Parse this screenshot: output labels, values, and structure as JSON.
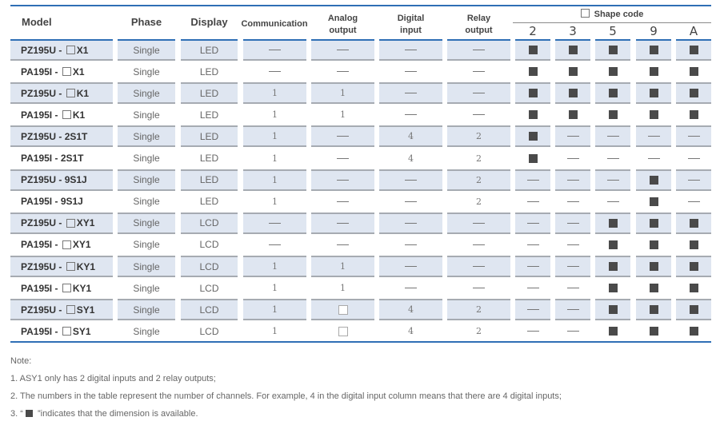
{
  "headers": {
    "model": "Model",
    "phase": "Phase",
    "display": "Display",
    "communication": "Communication",
    "analog_output": [
      "Analog",
      "output"
    ],
    "digital_input": [
      "Digital",
      "input"
    ],
    "relay_output": [
      "Relay",
      "output"
    ],
    "shape_code": "Shape code",
    "shape_codes": [
      "2",
      "3",
      "5",
      "9",
      "A"
    ]
  },
  "symbols": {
    "dash": "—",
    "filled": "filled-square",
    "empty": "empty-square"
  },
  "rows": [
    {
      "model_prefix": "PZ195U - ",
      "model_box": true,
      "model_suffix": "X1",
      "phase": "Single",
      "display": "LED",
      "communication": "—",
      "analog_output": "—",
      "digital_input": "—",
      "relay_output": "—",
      "shape": [
        "filled",
        "filled",
        "filled",
        "filled",
        "filled"
      ]
    },
    {
      "model_prefix": "PA195I - ",
      "model_box": true,
      "model_suffix": "X1",
      "phase": "Single",
      "display": "LED",
      "communication": "—",
      "analog_output": "—",
      "digital_input": "—",
      "relay_output": "—",
      "shape": [
        "filled",
        "filled",
        "filled",
        "filled",
        "filled"
      ]
    },
    {
      "model_prefix": "PZ195U - ",
      "model_box": true,
      "model_suffix": "K1",
      "phase": "Single",
      "display": "LED",
      "communication": "1",
      "analog_output": "1",
      "digital_input": "—",
      "relay_output": "—",
      "shape": [
        "filled",
        "filled",
        "filled",
        "filled",
        "filled"
      ]
    },
    {
      "model_prefix": "PA195I - ",
      "model_box": true,
      "model_suffix": "K1",
      "phase": "Single",
      "display": "LED",
      "communication": "1",
      "analog_output": "1",
      "digital_input": "—",
      "relay_output": "—",
      "shape": [
        "filled",
        "filled",
        "filled",
        "filled",
        "filled"
      ]
    },
    {
      "model_prefix": "PZ195U - ",
      "model_box": false,
      "model_suffix": "2S1T",
      "phase": "Single",
      "display": "LED",
      "communication": "1",
      "analog_output": "—",
      "digital_input": "4",
      "relay_output": "2",
      "shape": [
        "filled",
        "dash",
        "dash",
        "dash",
        "dash"
      ]
    },
    {
      "model_prefix": "PA195I - ",
      "model_box": false,
      "model_suffix": "2S1T",
      "phase": "Single",
      "display": "LED",
      "communication": "1",
      "analog_output": "—",
      "digital_input": "4",
      "relay_output": "2",
      "shape": [
        "filled",
        "dash",
        "dash",
        "dash",
        "dash"
      ]
    },
    {
      "model_prefix": "PZ195U - ",
      "model_box": false,
      "model_suffix": "9S1J",
      "phase": "Single",
      "display": "LED",
      "communication": "1",
      "analog_output": "—",
      "digital_input": "—",
      "relay_output": "2",
      "shape": [
        "dash",
        "dash",
        "dash",
        "filled",
        "dash"
      ]
    },
    {
      "model_prefix": "PA195I - ",
      "model_box": false,
      "model_suffix": "9S1J",
      "phase": "Single",
      "display": "LED",
      "communication": "1",
      "analog_output": "—",
      "digital_input": "—",
      "relay_output": "2",
      "shape": [
        "dash",
        "dash",
        "dash",
        "filled",
        "dash"
      ]
    },
    {
      "model_prefix": "PZ195U - ",
      "model_box": true,
      "model_suffix": "XY1",
      "phase": "Single",
      "display": "LCD",
      "communication": "—",
      "analog_output": "—",
      "digital_input": "—",
      "relay_output": "—",
      "shape": [
        "dash",
        "dash",
        "filled",
        "filled",
        "filled"
      ]
    },
    {
      "model_prefix": "PA195I - ",
      "model_box": true,
      "model_suffix": "XY1",
      "phase": "Single",
      "display": "LCD",
      "communication": "—",
      "analog_output": "—",
      "digital_input": "—",
      "relay_output": "—",
      "shape": [
        "dash",
        "dash",
        "filled",
        "filled",
        "filled"
      ]
    },
    {
      "model_prefix": "PZ195U - ",
      "model_box": true,
      "model_suffix": "KY1",
      "phase": "Single",
      "display": "LCD",
      "communication": "1",
      "analog_output": "1",
      "digital_input": "—",
      "relay_output": "—",
      "shape": [
        "dash",
        "dash",
        "filled",
        "filled",
        "filled"
      ]
    },
    {
      "model_prefix": "PA195I - ",
      "model_box": true,
      "model_suffix": "KY1",
      "phase": "Single",
      "display": "LCD",
      "communication": "1",
      "analog_output": "1",
      "digital_input": "—",
      "relay_output": "—",
      "shape": [
        "dash",
        "dash",
        "filled",
        "filled",
        "filled"
      ]
    },
    {
      "model_prefix": "PZ195U - ",
      "model_box": true,
      "model_suffix": "SY1",
      "phase": "Single",
      "display": "LCD",
      "communication": "1",
      "analog_output": "empty",
      "digital_input": "4",
      "relay_output": "2",
      "shape": [
        "dash",
        "dash",
        "filled",
        "filled",
        "filled"
      ]
    },
    {
      "model_prefix": "PA195I - ",
      "model_box": true,
      "model_suffix": "SY1",
      "phase": "Single",
      "display": "LCD",
      "communication": "1",
      "analog_output": "empty",
      "digital_input": "4",
      "relay_output": "2",
      "shape": [
        "dash",
        "dash",
        "filled",
        "filled",
        "filled"
      ]
    }
  ],
  "notes": {
    "title": "Note:",
    "items": [
      "1. ASY1 only has 2 digital inputs and 2 relay outputs;",
      "2. The numbers in the table represent the number of channels. For example, 4 in the digital input column means that there are 4 digital inputs;"
    ],
    "item3_prefix": "3. “",
    "item3_suffix": " ”indicates that the dimension is available."
  },
  "colors": {
    "accent_blue": "#2f6fb5",
    "row_shade": "#dfe6f1",
    "mark": "#4a4a4a"
  }
}
